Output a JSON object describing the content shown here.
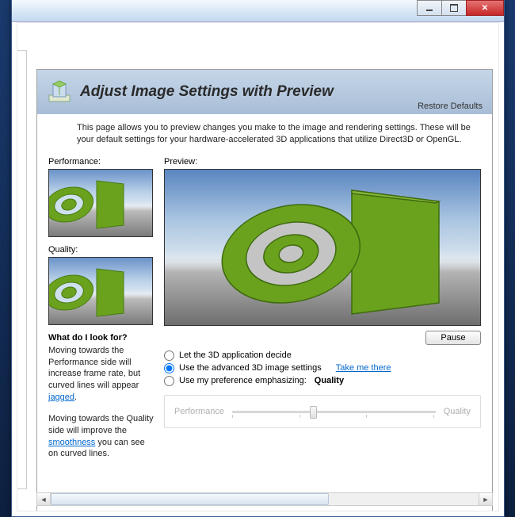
{
  "header": {
    "title": "Adjust Image Settings with Preview",
    "restore": "Restore Defaults"
  },
  "description": "This page allows you to preview changes you make to the image and rendering settings. These will be your default settings for your hardware-accelerated 3D applications that utilize Direct3D or OpenGL.",
  "left": {
    "perf_label": "Performance:",
    "qual_label": "Quality:",
    "sub_heading": "What do I look for?",
    "para1_a": "Moving towards the Performance side will increase frame rate, but curved lines will appear ",
    "para1_link": "jagged",
    "para1_b": ".",
    "para2_a": "Moving towards the Quality side will improve the ",
    "para2_link": "smoothness",
    "para2_b": " you can see on curved lines."
  },
  "preview": {
    "label": "Preview:",
    "pause": "Pause"
  },
  "options": {
    "opt1": "Let the 3D application decide",
    "opt2": "Use the advanced 3D image settings",
    "take_link": "Take me there",
    "opt3": "Use my preference emphasizing:",
    "opt3_value": "Quality",
    "selected": 2
  },
  "slider": {
    "left": "Performance",
    "right": "Quality",
    "pos": 38
  }
}
